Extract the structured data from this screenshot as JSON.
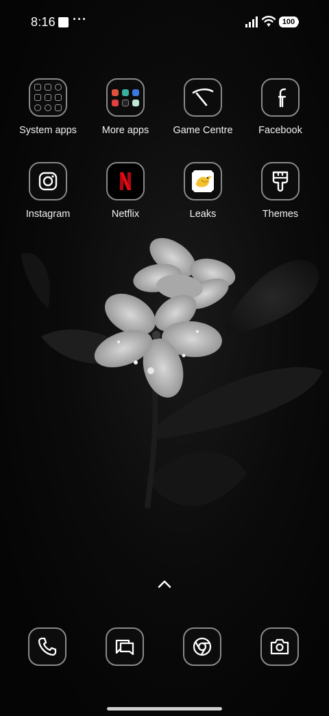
{
  "status_bar": {
    "time": "8:16",
    "more": "···",
    "battery": "100"
  },
  "home": {
    "apps": [
      {
        "label": "System apps",
        "icon": "system-apps-folder-icon"
      },
      {
        "label": "More apps",
        "icon": "more-apps-folder-icon"
      },
      {
        "label": "Game Centre",
        "icon": "game-centre-icon"
      },
      {
        "label": "Facebook",
        "icon": "facebook-icon"
      },
      {
        "label": "Instagram",
        "icon": "instagram-icon"
      },
      {
        "label": "Netflix",
        "icon": "netflix-icon"
      },
      {
        "label": "Leaks",
        "icon": "leaks-bird-icon"
      },
      {
        "label": "Themes",
        "icon": "themes-brush-icon"
      }
    ]
  },
  "dock": {
    "apps": [
      {
        "icon": "phone-icon"
      },
      {
        "icon": "messages-icon"
      },
      {
        "icon": "chrome-icon"
      },
      {
        "icon": "camera-icon"
      }
    ]
  },
  "colors": {
    "icon_border": "#8a8a8a",
    "netflix_red": "#e50914",
    "leaks_yellow": "#f2c230"
  }
}
